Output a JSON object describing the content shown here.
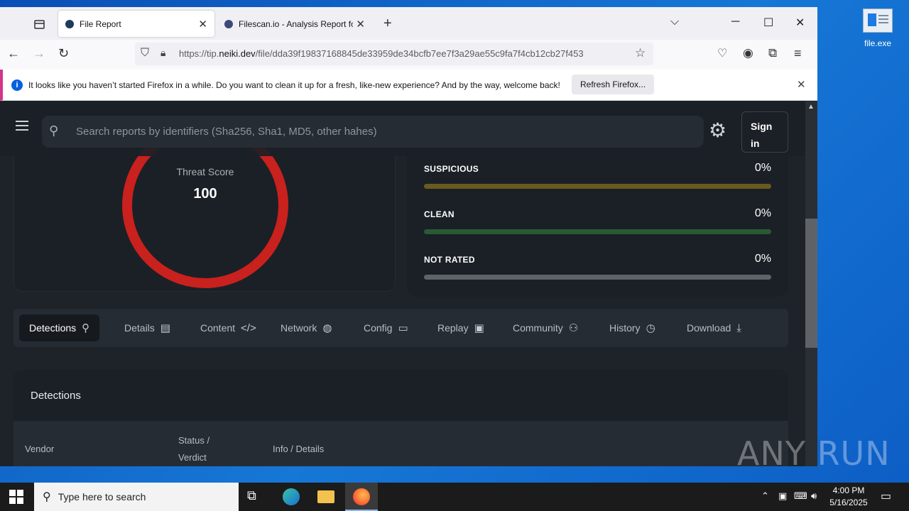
{
  "desktop": {
    "icon_label": "file.exe"
  },
  "browser": {
    "tabs": [
      {
        "title": "File Report",
        "active": true
      },
      {
        "title": "Filescan.io - Analysis Report for",
        "active": false
      }
    ],
    "url_prefix": "https://tip.",
    "url_domain": "neiki.dev",
    "url_path": "/file/dda39f19837168845de33959de34bcfb7ee7f3a29ae55c9fa7f4cb12cb27f453",
    "notification": {
      "text": "It looks like you haven’t started Firefox in a while. Do you want to clean it up for a fresh, like-new experience? And by the way, welcome back!",
      "button": "Refresh Firefox..."
    }
  },
  "header": {
    "search_placeholder": "Search reports by identifiers (Sha256, Sha1, MD5, other hahes)",
    "signin_line1": "Sign",
    "signin_line2": "in"
  },
  "threat": {
    "label": "Threat Score",
    "score": "100"
  },
  "stats": [
    {
      "label": "SUSPICIOUS",
      "percent": "0%",
      "color": "#6b5a1f"
    },
    {
      "label": "CLEAN",
      "percent": "0%",
      "color": "#2a5a35"
    },
    {
      "label": "NOT RATED",
      "percent": "0%",
      "color": "#5f6368"
    }
  ],
  "page_tabs": [
    {
      "label": "Detections",
      "icon": "search-icon"
    },
    {
      "label": "Details",
      "icon": "document-icon"
    },
    {
      "label": "Content",
      "icon": "code-icon"
    },
    {
      "label": "Network",
      "icon": "globe-icon"
    },
    {
      "label": "Config",
      "icon": "folder-gear-icon"
    },
    {
      "label": "Replay",
      "icon": "monitor-icon"
    },
    {
      "label": "Community",
      "icon": "community-icon"
    },
    {
      "label": "History",
      "icon": "clock-icon"
    },
    {
      "label": "Download",
      "icon": "download-icon"
    }
  ],
  "detections": {
    "title": "Detections",
    "columns": [
      "Vendor",
      "Status / Verdict",
      "Info / Details"
    ],
    "status_line1": "Status /",
    "status_line2": "Verdict"
  },
  "watermark": "ANY RUN",
  "taskbar": {
    "search_placeholder": "Type here to search",
    "time": "4:00 PM",
    "date": "5/16/2025"
  }
}
